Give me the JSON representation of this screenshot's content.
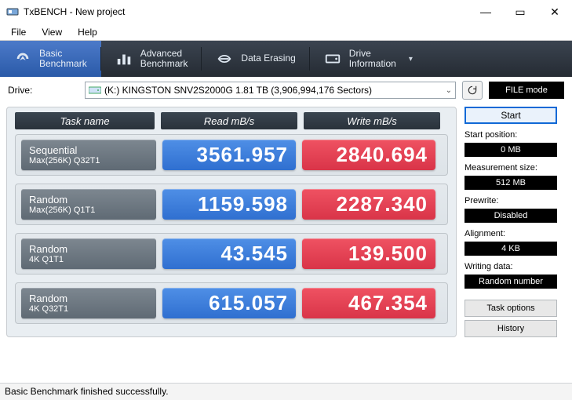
{
  "window": {
    "title": "TxBENCH - New project",
    "menus": [
      "File",
      "View",
      "Help"
    ]
  },
  "tabs": [
    {
      "id": "basic",
      "line1": "Basic",
      "line2": "Benchmark",
      "active": true
    },
    {
      "id": "advanced",
      "line1": "Advanced",
      "line2": "Benchmark",
      "active": false
    },
    {
      "id": "erase",
      "line1": "Data Erasing",
      "line2": "",
      "active": false
    },
    {
      "id": "info",
      "line1": "Drive",
      "line2": "Information",
      "active": false,
      "dropdown": true
    }
  ],
  "drive": {
    "label": "Drive:",
    "selected": "(K:) KINGSTON SNV2S2000G   1.81 TB (3,906,994,176 Sectors)",
    "filemode_label": "FILE mode"
  },
  "columns": {
    "name": "Task name",
    "read": "Read mB/s",
    "write": "Write mB/s"
  },
  "rows": [
    {
      "name1": "Sequential",
      "name2": "Max(256K) Q32T1",
      "read": "3561.957",
      "write": "2840.694"
    },
    {
      "name1": "Random",
      "name2": "Max(256K) Q1T1",
      "read": "1159.598",
      "write": "2287.340"
    },
    {
      "name1": "Random",
      "name2": "4K Q1T1",
      "read": "43.545",
      "write": "139.500"
    },
    {
      "name1": "Random",
      "name2": "4K Q32T1",
      "read": "615.057",
      "write": "467.354"
    }
  ],
  "side": {
    "start": "Start",
    "start_pos_label": "Start position:",
    "start_pos_value": "0 MB",
    "meas_label": "Measurement size:",
    "meas_value": "512 MB",
    "prewrite_label": "Prewrite:",
    "prewrite_value": "Disabled",
    "align_label": "Alignment:",
    "align_value": "4 KB",
    "writing_label": "Writing data:",
    "writing_value": "Random number",
    "task_options": "Task options",
    "history": "History"
  },
  "status": "Basic Benchmark finished successfully."
}
